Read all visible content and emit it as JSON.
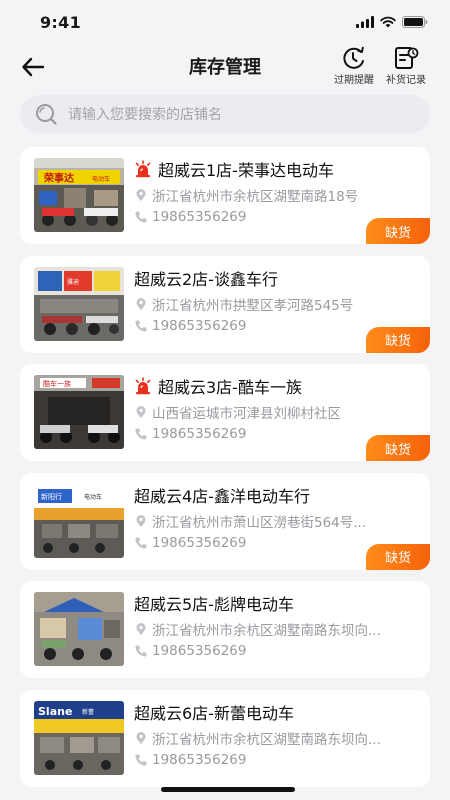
{
  "status": {
    "time": "9:41"
  },
  "nav": {
    "title": "库存管理",
    "expire_label": "过期提醒",
    "restock_label": "补货记录"
  },
  "search": {
    "placeholder": "请输入您要搜索的店铺名"
  },
  "colors": {
    "accent": "#f5620a",
    "alarm": "#e8321e"
  },
  "stores": [
    {
      "name": "超威云1店-荣事达电动车",
      "address": "浙江省杭州市余杭区湖墅南路18号",
      "phone": "19865356269",
      "alarm": true,
      "badge": "缺货"
    },
    {
      "name": "超威云2店-谈鑫车行",
      "address": "浙江省杭州市拱墅区孝河路545号",
      "phone": "19865356269",
      "alarm": false,
      "badge": "缺货"
    },
    {
      "name": "超威云3店-酷车一族",
      "address": "山西省运城市河津县刘柳村社区",
      "phone": "19865356269",
      "alarm": true,
      "badge": "缺货"
    },
    {
      "name": "超威云4店-鑫洋电动车行",
      "address": "浙江省杭州市萧山区澇巷街564号...",
      "phone": "19865356269",
      "alarm": false,
      "badge": "缺货"
    },
    {
      "name": "超威云5店-彪牌电动车",
      "address": "浙江省杭州市余杭区湖墅南路东坝向...",
      "phone": "19865356269",
      "alarm": false,
      "badge": ""
    },
    {
      "name": "超威云6店-新蕾电动车",
      "address": "浙江省杭州市余杭区湖墅南路东坝向...",
      "phone": "19865356269",
      "alarm": false,
      "badge": ""
    }
  ]
}
